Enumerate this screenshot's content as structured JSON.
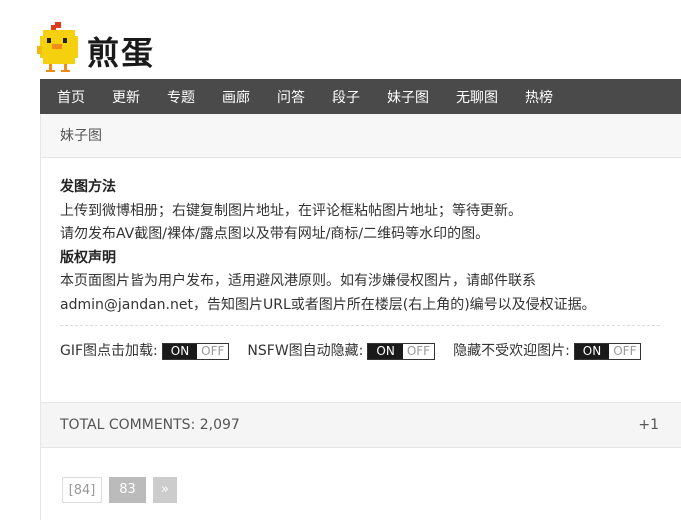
{
  "logo": {
    "text": "煎蛋"
  },
  "nav": {
    "items": [
      {
        "label": "首页"
      },
      {
        "label": "更新"
      },
      {
        "label": "专题"
      },
      {
        "label": "画廊"
      },
      {
        "label": "问答"
      },
      {
        "label": "段子"
      },
      {
        "label": "妹子图"
      },
      {
        "label": "无聊图"
      },
      {
        "label": "热榜"
      }
    ]
  },
  "section": {
    "title": "妹子图"
  },
  "info": {
    "heading1": "发图方法",
    "line1": "上传到微博相册；右键复制图片地址，在评论框粘帖图片地址；等待更新。",
    "line2": "请勿发布AV截图/裸体/露点图以及带有网址/商标/二维码等水印的图。",
    "heading2": "版权声明",
    "line3": "本页面图片皆为用户发布，适用避风港原则。如有涉嫌侵权图片，请邮件联系",
    "line4": "admin@jandan.net，告知图片URL或者图片所在楼层(右上角的)编号以及侵权证据。"
  },
  "toggles": [
    {
      "label": "GIF图点击加载:",
      "on": "ON",
      "off": "OFF"
    },
    {
      "label": "NSFW图自动隐藏:",
      "on": "ON",
      "off": "OFF"
    },
    {
      "label": "隐藏不受欢迎图片:",
      "on": "ON",
      "off": "OFF"
    }
  ],
  "comments": {
    "total": "TOTAL COMMENTS: 2,097",
    "plus": "+1"
  },
  "pager": {
    "current": "[84]",
    "next_page": "83",
    "next_arrow": "»"
  },
  "colors": {
    "nav_bg": "#4a4a4a",
    "chick_yellow": "#f5d00f"
  }
}
